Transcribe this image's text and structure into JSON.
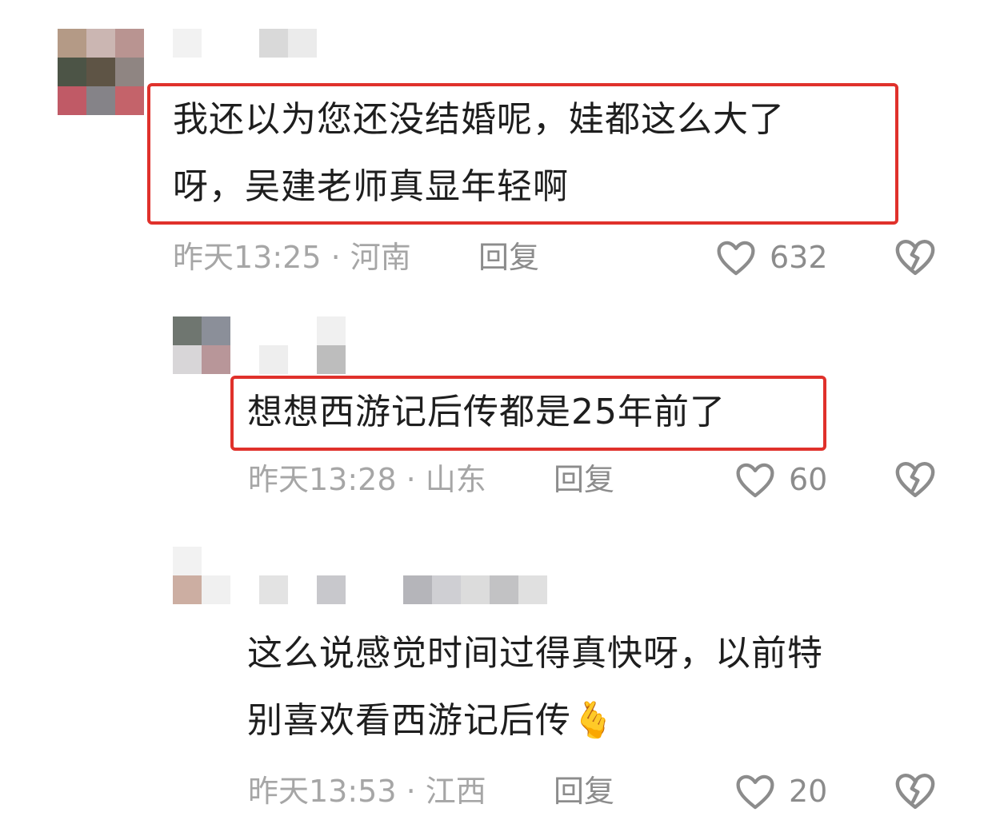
{
  "comments": [
    {
      "text_lines": [
        "我还以为您还没结婚呢，娃都这么大了",
        "呀，吴建老师真显年轻啊"
      ],
      "time": "昨天13:25",
      "location": "河南",
      "reply_label": "回复",
      "likes": "632"
    },
    {
      "text_lines": [
        "想想西游记后传都是25年前了"
      ],
      "time": "昨天13:28",
      "location": "山东",
      "reply_label": "回复",
      "likes": "60"
    },
    {
      "text_lines": [
        "这么说感觉时间过得真快呀，以前特",
        "别喜欢看西游记后传"
      ],
      "time": "昨天13:53",
      "location": "江西",
      "reply_label": "回复",
      "likes": "20",
      "emoji": "🫰"
    }
  ],
  "meta_separator": "·",
  "icons": {
    "like": "heart-outline-icon",
    "dislike": "broken-heart-icon"
  },
  "colors": {
    "highlight_box": "#e0312b",
    "meta_text": "#a6a6a6",
    "body_text": "#1e1e1e"
  }
}
